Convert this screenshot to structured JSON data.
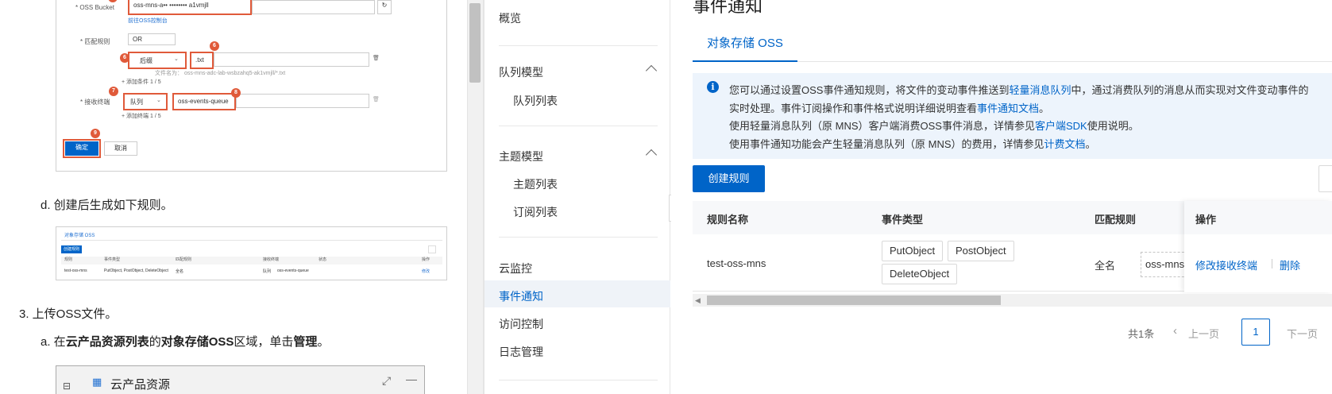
{
  "doc": {
    "shot1": {
      "oss_bucket_label": "* OSS Bucket",
      "oss_bucket_value": "oss-mns-a•• •••••••• a1vmjll",
      "goto_oss_console": "前往OSS控制台",
      "match_rule_label": "* 匹配规则",
      "match_or": "OR",
      "suffix_select": "后缀",
      "suffix_value": ".txt",
      "file_name_hint": "文件名为： oss-mns-adc-lab-wsbzahq5-ak1vmjll/*.txt",
      "add_condition": "+ 添加条件 1 / 5",
      "receive_endpoint_label": "* 接收终端",
      "queue_select": "队列",
      "queue_value": "oss-events-queue",
      "add_endpoint": "+ 添加终端 1 / 5",
      "confirm_button": "确定",
      "cancel_button": "取消",
      "badges": [
        "6",
        "6",
        "7",
        "8",
        "9"
      ]
    },
    "step_d": "d. 创建后生成如下规则。",
    "shot2": {
      "tab": "对象存储 OSS",
      "btn": "创建规则",
      "headers": [
        "规则",
        "事件类型",
        "匹配规则",
        "接收终端",
        "状态",
        "操作"
      ],
      "row": [
        "test-oss-mns",
        "PutObject, PostObject, DeleteObject",
        "全名",
        "队列",
        "oss-events-queue",
        "修改"
      ]
    },
    "step_3": "3. 上传OSS文件。",
    "step_a": {
      "pre": "a. 在",
      "b1": "云产品资源列表",
      "mid1": "的",
      "b2": "对象存储OSS",
      "mid2": "区域，单击",
      "b3": "管理",
      "end": "。"
    },
    "shot3_title": "云产品资源"
  },
  "sidebar": {
    "overview": "概览",
    "queue_model": "队列模型",
    "queue_list": "队列列表",
    "topic_model": "主题模型",
    "topic_list": "主题列表",
    "subscription_list": "订阅列表",
    "cloud_monitor": "云监控",
    "event_notification": "事件通知",
    "access_control": "访问控制",
    "log_management": "日志管理"
  },
  "main": {
    "title": "事件通知",
    "tab": "对象存储 OSS",
    "notice": {
      "l1_a": "您可以通过设置OSS事件通知规则，将文件的变动事件推送到",
      "l1_link": "轻量消息队列",
      "l1_b": "中，通过消费队列的消息从而实现对文件变动事件的",
      "l2_a": "实时处理。事件订阅操作和事件格式说明详细说明查看",
      "l2_link": "事件通知文档",
      "l2_b": "。",
      "l3_a": "使用轻量消息队列（原 MNS）客户端消费OSS事件消息，详情参见",
      "l3_link": "客户端SDK",
      "l3_b": "使用说明。",
      "l4_a": "使用事件通知功能会产生轻量消息队列（原 MNS）的费用，详情参见",
      "l4_link": "计费文档",
      "l4_b": "。"
    },
    "create_rule": "创建规则",
    "table": {
      "headers": {
        "name": "规则名称",
        "event_type": "事件类型",
        "match_rule": "匹配规则",
        "actions": "操作"
      },
      "row": {
        "name": "test-oss-mns",
        "events": [
          "PutObject",
          "PostObject",
          "DeleteObject"
        ],
        "match_type": "全名",
        "match_value": "oss-mns-",
        "action_edit": "修改接收终端",
        "action_delete": "删除"
      }
    },
    "pagination": {
      "total": "共1条",
      "prev": "上一页",
      "page": "1",
      "next": "下一页"
    }
  },
  "colors": {
    "accent": "#0064c8",
    "notice_bg": "#edf4fc",
    "annotation_red": "#e05a3a"
  }
}
